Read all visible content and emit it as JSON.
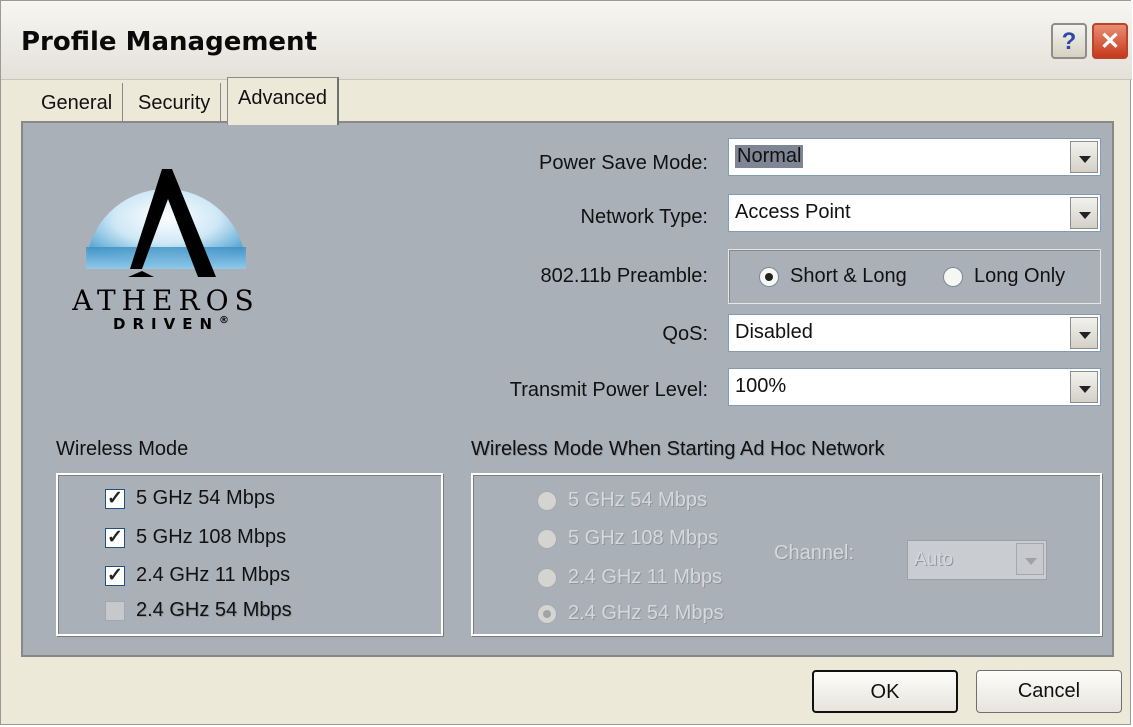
{
  "window": {
    "title": "Profile Management",
    "help_glyph": "?",
    "close_glyph": "✕"
  },
  "tabs": [
    {
      "label": "General"
    },
    {
      "label": "Security"
    },
    {
      "label": "Advanced",
      "active": true
    }
  ],
  "logo": {
    "word": "ATHEROS",
    "tagline": "DRIVEN",
    "mark": "®"
  },
  "settings": {
    "power_save_mode": {
      "label": "Power Save Mode:",
      "value": "Normal"
    },
    "network_type": {
      "label": "Network Type:",
      "value": "Access Point"
    },
    "preamble": {
      "label": "802.11b Preamble:",
      "options": [
        "Short & Long",
        "Long Only"
      ],
      "selected": "Short & Long"
    },
    "qos": {
      "label": "QoS:",
      "value": "Disabled"
    },
    "transmit_power": {
      "label": "Transmit Power Level:",
      "value": "100%"
    }
  },
  "wireless_mode": {
    "label": "Wireless Mode",
    "options": [
      {
        "label": "5 GHz 54 Mbps",
        "checked": true,
        "enabled": true
      },
      {
        "label": "5 GHz 108 Mbps",
        "checked": true,
        "enabled": true
      },
      {
        "label": "2.4 GHz 11 Mbps",
        "checked": true,
        "enabled": true
      },
      {
        "label": "2.4 GHz 54 Mbps",
        "checked": false,
        "enabled": false
      }
    ]
  },
  "adhoc_mode": {
    "label": "Wireless Mode When Starting Ad Hoc Network",
    "enabled": false,
    "options": [
      {
        "label": "5 GHz 54 Mbps",
        "selected": false
      },
      {
        "label": "5 GHz 108 Mbps",
        "selected": false
      },
      {
        "label": "2.4 GHz 11 Mbps",
        "selected": false
      },
      {
        "label": "2.4 GHz 54 Mbps",
        "selected": true
      }
    ],
    "channel_label": "Channel:",
    "channel_value": "Auto"
  },
  "buttons": {
    "ok": "OK",
    "cancel": "Cancel"
  },
  "colors": {
    "panel": "#aab0b8",
    "dialog": "#ece9d8",
    "close_button": "#c8391c"
  }
}
